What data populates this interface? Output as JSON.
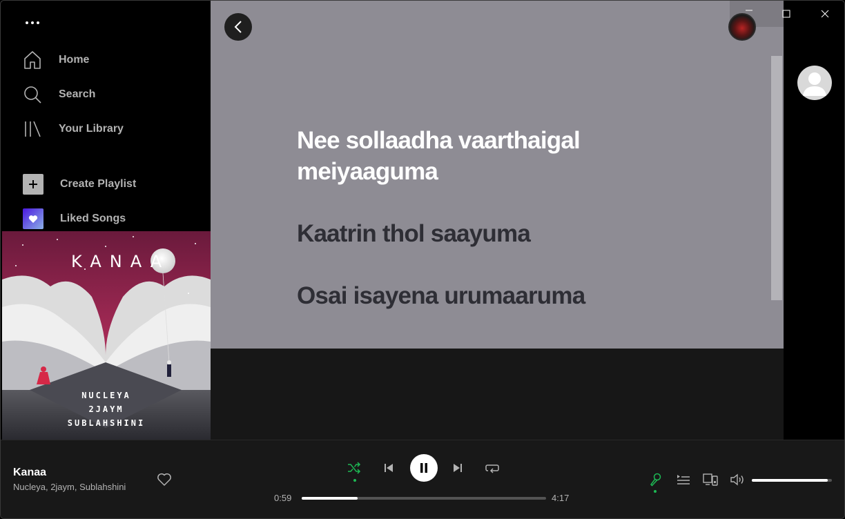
{
  "sidebar": {
    "menu_icon": "more-dots-icon",
    "nav": [
      {
        "label": "Home",
        "icon": "home-icon"
      },
      {
        "label": "Search",
        "icon": "search-icon"
      },
      {
        "label": "Your Library",
        "icon": "library-icon"
      }
    ],
    "create_playlist": "Create Playlist",
    "liked_songs": "Liked Songs"
  },
  "album": {
    "title": "KANAA",
    "artists_art": [
      "NUCLEYA",
      "2JAYM",
      "SUBLAHSHINI"
    ]
  },
  "lyrics": {
    "lines": [
      {
        "text": "Nee sollaadha vaarthaigal meiyaaguma",
        "active": true
      },
      {
        "text": "Kaatrin thol saayuma",
        "active": false
      },
      {
        "text": "Osai isayena urumaaruma",
        "active": false
      }
    ],
    "background_color": "#8e8c94"
  },
  "player": {
    "track_title": "Kanaa",
    "track_artists": "Nucleya, 2jaym, Sublahshini",
    "current_time": "0:59",
    "total_time": "4:17",
    "progress_fraction": 0.23,
    "volume_fraction": 0.95,
    "shuffle_active": true,
    "lyrics_active": true,
    "accent_color": "#1db954"
  }
}
